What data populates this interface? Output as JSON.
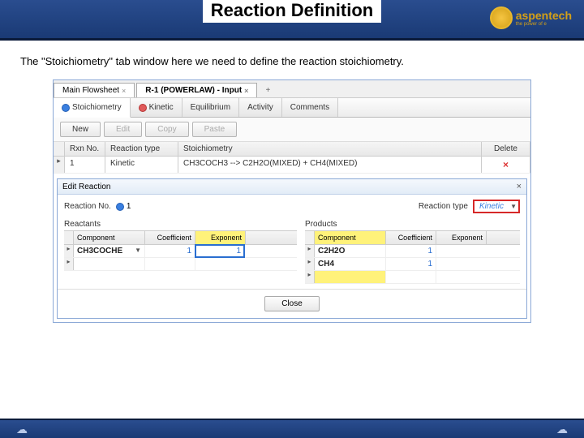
{
  "slide": {
    "title": "Reaction Definition",
    "logo_text": "aspentech",
    "logo_sub": "the power of e",
    "description": "The \"Stoichiometry\" tab window here we need to define the reaction stoichiometry."
  },
  "tabs": {
    "flowsheet": "Main Flowsheet",
    "input": "R-1 (POWERLAW) - Input",
    "add": "+"
  },
  "subtabs": {
    "stoich": "Stoichiometry",
    "kinetic": "Kinetic",
    "equilibrium": "Equilibrium",
    "activity": "Activity",
    "comments": "Comments"
  },
  "toolbar": {
    "new": "New",
    "edit": "Edit",
    "copy": "Copy",
    "paste": "Paste"
  },
  "grid": {
    "headers": {
      "rxn": "Rxn No.",
      "type": "Reaction type",
      "stoich": "Stoichiometry",
      "del": "Delete"
    },
    "row1": {
      "rxn": "1",
      "type": "Kinetic",
      "stoich": "CH3COCH3 --> C2H2O(MIXED) + CH4(MIXED)"
    }
  },
  "dialog": {
    "title": "Edit Reaction",
    "rxn_no_label": "Reaction No.",
    "rxn_no_val": "1",
    "rxn_type_label": "Reaction type",
    "rxn_type_val": "Kinetic",
    "reactants_title": "Reactants",
    "products_title": "Products",
    "table_headers": {
      "comp": "Component",
      "coef": "Coefficient",
      "exp": "Exponent"
    },
    "reactants": [
      {
        "comp": "CH3COCHE",
        "coef": "1",
        "exp": "1"
      }
    ],
    "products": [
      {
        "comp": "C2H2O",
        "coef": "1",
        "exp": ""
      },
      {
        "comp": "CH4",
        "coef": "1",
        "exp": ""
      }
    ],
    "close": "Close"
  }
}
